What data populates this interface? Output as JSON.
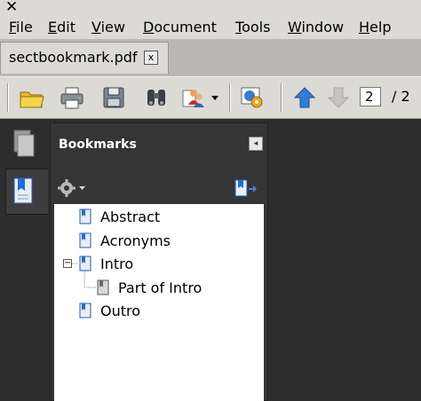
{
  "window": {
    "close_glyph": "✕"
  },
  "menu": {
    "items": [
      "File",
      "Edit",
      "View",
      "Document",
      "Tools",
      "Window",
      "Help"
    ]
  },
  "tab": {
    "label": "sectbookmark.pdf",
    "close_glyph": "x"
  },
  "toolbar": {
    "icons": [
      "open-folder-icon",
      "print-icon",
      "save-icon",
      "find-icon",
      "collaborate-icon",
      "properties-icon",
      "previous-page-icon",
      "next-page-icon"
    ],
    "page_current": "2",
    "page_total": "/ 2"
  },
  "panel": {
    "title": "Bookmarks",
    "collapse_glyph": "◂",
    "options_glyph": "▾"
  },
  "bookmarks": [
    {
      "label": "Abstract",
      "level": 0
    },
    {
      "label": "Acronyms",
      "level": 0
    },
    {
      "label": "Intro",
      "level": 0,
      "expanded": true,
      "toggle": "−"
    },
    {
      "label": "Part of Intro",
      "level": 1
    },
    {
      "label": "Outro",
      "level": 0
    }
  ],
  "colors": {
    "accent": "#1e6fd0",
    "dark_bg": "#2d2d2d",
    "panel_bg": "#353535"
  }
}
